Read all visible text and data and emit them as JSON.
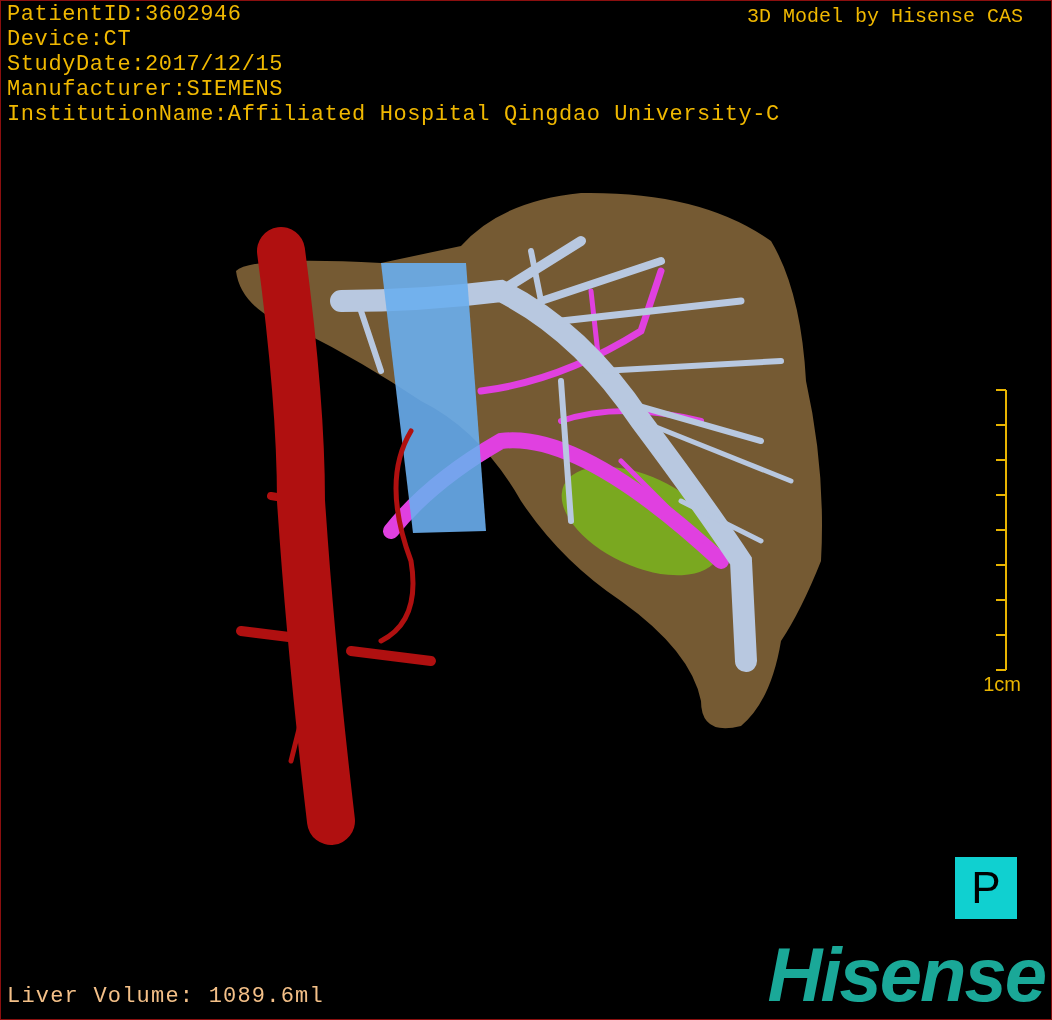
{
  "patient_info": [
    "PatientID:3602946",
    "Device:CT",
    "StudyDate:2017/12/15",
    "Manufacturer:SIEMENS",
    "InstitutionName:Affiliated Hospital Qingdao University-C"
  ],
  "credit": "3D Model by Hisense CAS",
  "scale_bar": {
    "label": "1cm"
  },
  "orientation_marker": "P",
  "liver_volume": "Liver Volume: 1089.6ml",
  "logo": "Hisense"
}
